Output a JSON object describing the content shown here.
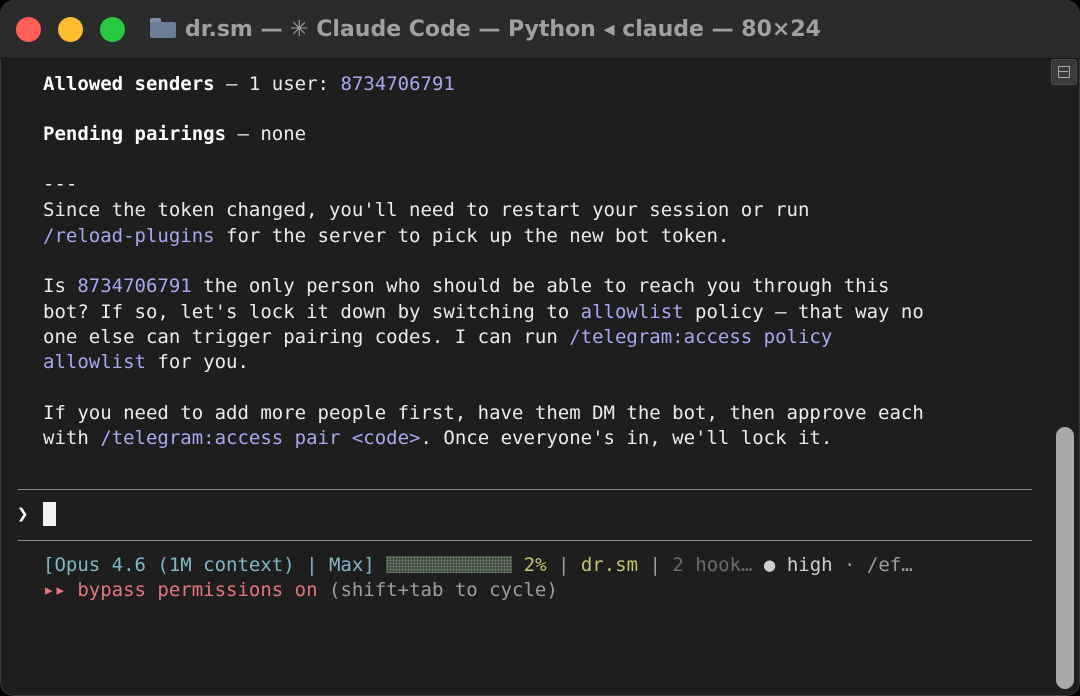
{
  "window": {
    "title": "dr.sm — ✳ Claude Code — Python ◂ claude — 80×24",
    "folder_icon": "folder-icon",
    "traffic_lights": {
      "close": "#ff5f57",
      "minimize": "#febc2e",
      "zoom": "#28c840"
    }
  },
  "output": {
    "allowed_label": "Allowed senders",
    "allowed_rest": " — 1 user: ",
    "user_id": "8734706791",
    "pending_label": "Pending pairings",
    "pending_rest": " — none",
    "rule": "---",
    "para1_line1": "Since the token changed, you'll need to restart your session or run",
    "para1_cmd": "/reload-plugins",
    "para1_line2_rest": " for the server to pick up the new bot token.",
    "para2_line1_pre": "Is ",
    "para2_line1_id": "8734706791",
    "para2_line1_post": " the only person who should be able to reach you through this",
    "para2_line2_pre": "bot? If so, let's lock it down by switching to ",
    "para2_line2_cmd": "allowlist",
    "para2_line2_post": " policy — that way no",
    "para2_line3_pre": "one else can trigger pairing codes. I can run ",
    "para2_line3_cmd": "/telegram:access policy",
    "para2_line4_cmd": "allowlist",
    "para2_line4_post": " for you.",
    "para3_line1": "If you need to add more people first, have them DM the bot, then approve each",
    "para3_line2_pre": "with ",
    "para3_line2_cmd": "/telegram:access pair <code>",
    "para3_line2_post": ". Once everyone's in, we'll lock it."
  },
  "input": {
    "prompt": "❯",
    "value": ""
  },
  "status": {
    "model": "[Opus 4.6 (1M context) | Max]",
    "context_usage": 0.02,
    "context_percent": "2%",
    "sep1": " | ",
    "project": "dr.sm",
    "sep2": " | ",
    "hooks": "2 hook…",
    "effort_dot": "●",
    "effort": " high",
    "tail": " · /ef…"
  },
  "mode": {
    "arrows": "▸▸",
    "label": " bypass permissions on",
    "hint": " (shift+tab to cycle)"
  },
  "colors": {
    "background": "#1e1e1e",
    "highlight": "#a8a8f0",
    "status_cyan": "#7fb7c8",
    "status_yellow": "#c4c46a",
    "bypass_pink": "#e5767c"
  }
}
